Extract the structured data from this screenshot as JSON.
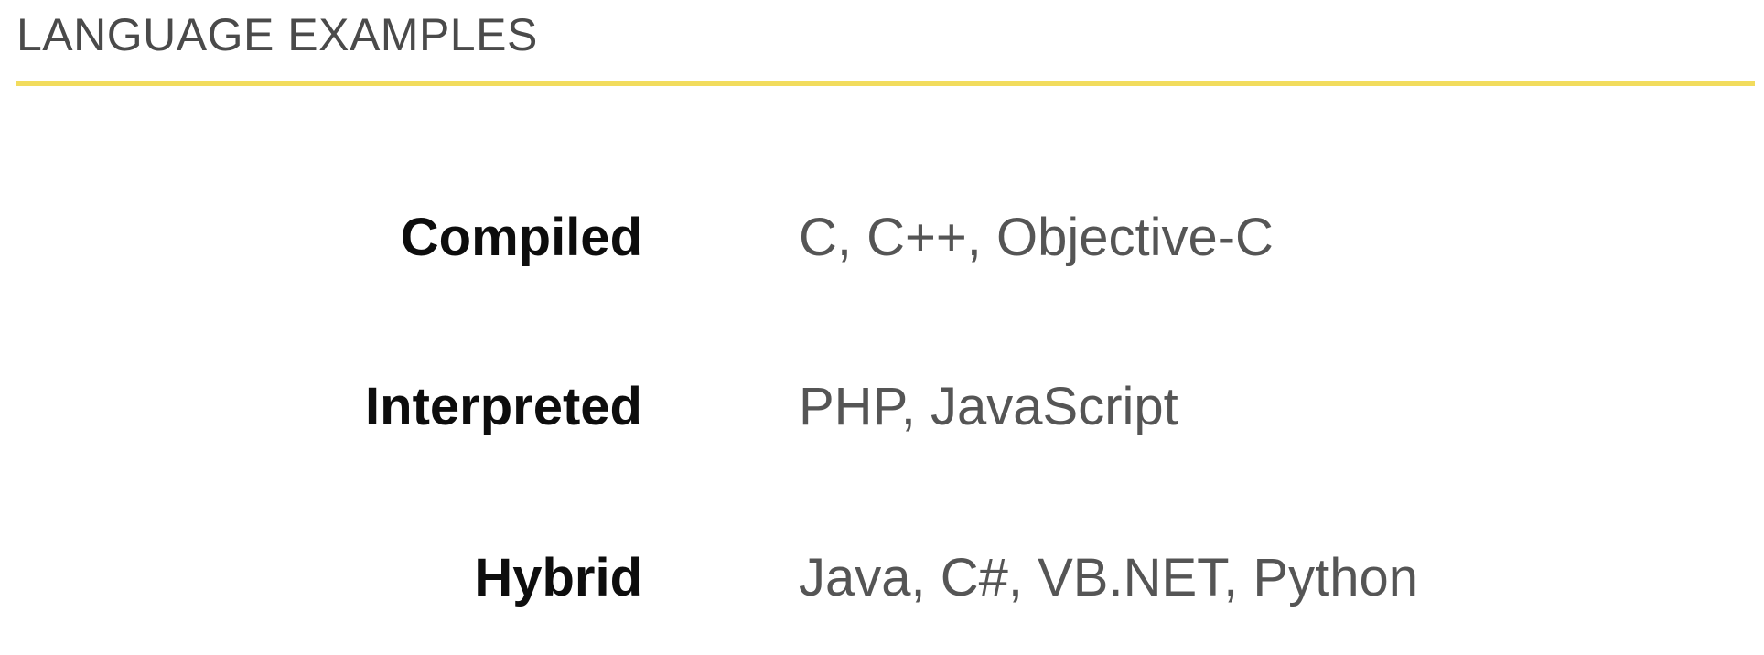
{
  "header": {
    "title": "LANGUAGE EXAMPLES"
  },
  "colors": {
    "accent_rule": "#f2dc5d",
    "label_text": "#0d0d0d",
    "value_text": "#555555",
    "title_text": "#4a4a4a"
  },
  "rows": [
    {
      "label": "Compiled",
      "value": "C, C++, Objective-C"
    },
    {
      "label": "Interpreted",
      "value": "PHP, JavaScript"
    },
    {
      "label": "Hybrid",
      "value": "Java, C#, VB.NET, Python"
    }
  ]
}
